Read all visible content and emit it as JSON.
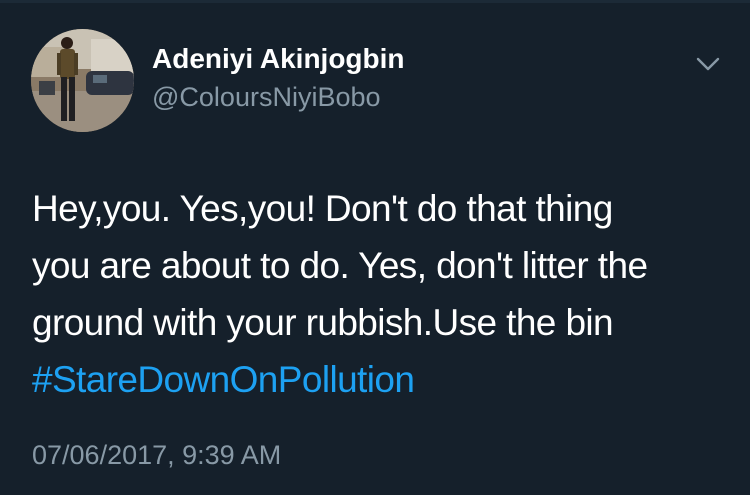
{
  "tweet": {
    "author": {
      "display_name": "Adeniyi Akinjogbin",
      "handle": "@ColoursNiyiBobo"
    },
    "avatar_icon": "profile-photo",
    "menu_icon": "chevron-down-icon",
    "text_lines": [
      "Hey,you. Yes,you! Don't do that thing",
      "you are about to do. Yes, don't litter the",
      "ground with your rubbish.Use the bin"
    ],
    "hashtag": "#StareDownOnPollution",
    "timestamp": "07/06/2017, 9:39 AM"
  },
  "colors": {
    "background": "#15202b",
    "text": "#ffffff",
    "secondary_text": "#8899a6",
    "link": "#1da1f2"
  }
}
